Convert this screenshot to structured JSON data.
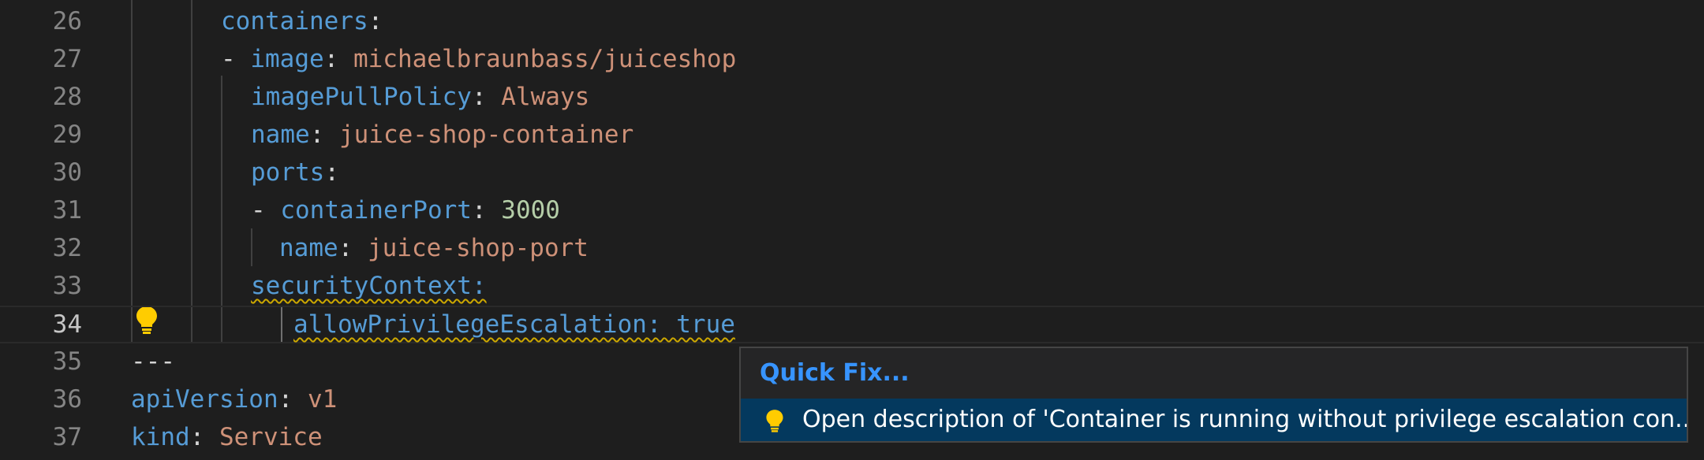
{
  "editor": {
    "lines": [
      {
        "num": "26",
        "parts": [
          {
            "t": "containers",
            "c": "key"
          },
          {
            "t": ":",
            "c": "pun"
          }
        ]
      },
      {
        "num": "27",
        "parts": [
          {
            "t": "- ",
            "c": "pun"
          },
          {
            "t": "image",
            "c": "key"
          },
          {
            "t": ": ",
            "c": "pun"
          },
          {
            "t": "michaelbraunbass/juiceshop",
            "c": "str"
          }
        ]
      },
      {
        "num": "28",
        "parts": [
          {
            "t": "imagePullPolicy",
            "c": "key"
          },
          {
            "t": ": ",
            "c": "pun"
          },
          {
            "t": "Always",
            "c": "str"
          }
        ]
      },
      {
        "num": "29",
        "parts": [
          {
            "t": "name",
            "c": "key"
          },
          {
            "t": ": ",
            "c": "pun"
          },
          {
            "t": "juice-shop-container",
            "c": "str"
          }
        ]
      },
      {
        "num": "30",
        "parts": [
          {
            "t": "ports",
            "c": "key"
          },
          {
            "t": ":",
            "c": "pun"
          }
        ]
      },
      {
        "num": "31",
        "parts": [
          {
            "t": "- ",
            "c": "pun"
          },
          {
            "t": "containerPort",
            "c": "key"
          },
          {
            "t": ": ",
            "c": "pun"
          },
          {
            "t": "3000",
            "c": "num"
          }
        ]
      },
      {
        "num": "32",
        "parts": [
          {
            "t": "name",
            "c": "key"
          },
          {
            "t": ": ",
            "c": "pun"
          },
          {
            "t": "juice-shop-port",
            "c": "str"
          }
        ]
      },
      {
        "num": "33",
        "parts": [
          {
            "t": "securityContext:",
            "c": "key warn"
          }
        ]
      },
      {
        "num": "34",
        "parts": [
          {
            "t": "allowPrivilegeEscalation: true",
            "c": "key warn"
          }
        ]
      },
      {
        "num": "35",
        "parts": [
          {
            "t": "---",
            "c": "pun"
          }
        ]
      },
      {
        "num": "36",
        "parts": [
          {
            "t": "apiVersion",
            "c": "key"
          },
          {
            "t": ": ",
            "c": "pun"
          },
          {
            "t": "v1",
            "c": "str"
          }
        ]
      },
      {
        "num": "37",
        "parts": [
          {
            "t": "kind",
            "c": "key"
          },
          {
            "t": ": ",
            "c": "pun"
          },
          {
            "t": "Service",
            "c": "str"
          }
        ]
      }
    ]
  },
  "quick_fix": {
    "title": "Quick Fix...",
    "item": "Open description of 'Container is running without privilege escalation con..."
  },
  "colors": {
    "background": "#1e1e1e",
    "key": "#569cd6",
    "string": "#ce9178",
    "number": "#b5cea8",
    "warning": "#cca700",
    "selection": "#04395e"
  }
}
